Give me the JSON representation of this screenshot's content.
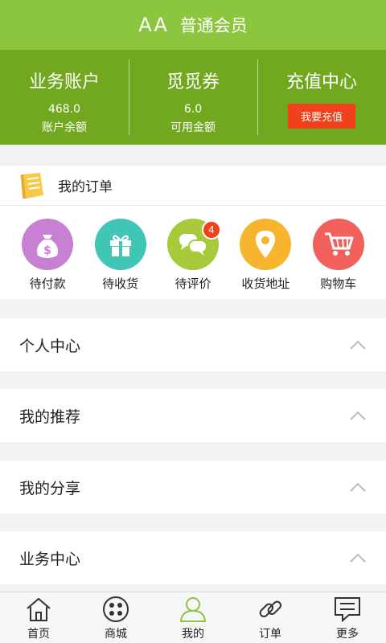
{
  "header": {
    "name": "AA",
    "level": "普通会员"
  },
  "account": {
    "business": {
      "title": "业务账户",
      "value": "468.0",
      "sub": "账户余额"
    },
    "coupon": {
      "title": "觅觅券",
      "value": "6.0",
      "sub": "可用金额"
    },
    "recharge": {
      "title": "充值中心",
      "button": "我要充值"
    }
  },
  "orders": {
    "title": "我的订单",
    "items": [
      {
        "label": "待付款",
        "icon": "money-bag-icon",
        "color": "#c880d3"
      },
      {
        "label": "待收货",
        "icon": "gift-icon",
        "color": "#3fc6b4"
      },
      {
        "label": "待评价",
        "icon": "chat-bubbles-icon",
        "color": "#a8ca3a",
        "badge": "4"
      },
      {
        "label": "收货地址",
        "icon": "location-pin-icon",
        "color": "#f6b52c"
      },
      {
        "label": "购物车",
        "icon": "shopping-cart-icon",
        "color": "#f2605c"
      }
    ]
  },
  "sections": [
    {
      "title": "个人中心"
    },
    {
      "title": "我的推荐"
    },
    {
      "title": "我的分享"
    },
    {
      "title": "业务中心"
    }
  ],
  "tabbar": [
    {
      "label": "首页",
      "icon": "home-icon"
    },
    {
      "label": "商城",
      "icon": "store-icon"
    },
    {
      "label": "我的",
      "icon": "user-icon",
      "active": true
    },
    {
      "label": "订单",
      "icon": "link-icon"
    },
    {
      "label": "更多",
      "icon": "message-icon"
    }
  ],
  "colors": {
    "header": "#8cc63f",
    "account": "#72a81f",
    "accent": "#f0411a",
    "active_tab": "#8cc63f"
  }
}
